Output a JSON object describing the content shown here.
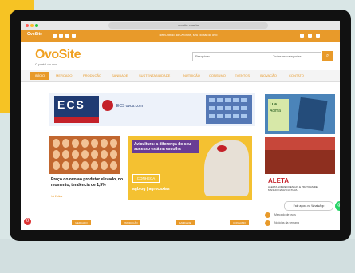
{
  "browser": {
    "url": "ovosite.com.br"
  },
  "header": {
    "small_logo": "OvoSite",
    "ticker": "Bem-vindo ao OvoSite, seu portal do ovo"
  },
  "logo": {
    "name": "OvoSite",
    "tagline": "O portal do ovo"
  },
  "search": {
    "placeholder": "Pesquisar",
    "category": "Todas as categorias",
    "button_icon": "search-icon"
  },
  "nav": {
    "active": "INÍCIO",
    "items": [
      "MERCADO",
      "PRODUÇÃO",
      "SANIDADE",
      "SUSTENTABILIDADE",
      "NUTRIÇÃO",
      "CONSUMO",
      "EVENTOS",
      "INOVAÇÃO",
      "CONTATO"
    ]
  },
  "banner": {
    "brand": "ECS",
    "text": "ECS ovos.com"
  },
  "side_ad1": {
    "line1": "Lua",
    "line2": "Acima"
  },
  "news": {
    "title": "Preço do ovo ao produtor elevado, no momento, tendência de 1,5%",
    "meta": "há 2 dias"
  },
  "promo": {
    "title": "Avicultura: a diferença do seu sucesso está na escolha",
    "button": "CONHEÇA",
    "logos": "agblog | agrocaxias"
  },
  "side_ad2": {
    "title": "ALETA",
    "subtitle": "ALERTA SOBRE DOENÇAS E PRÁTICAS DE MANEJO NA AVICULTURA"
  },
  "whatsapp": {
    "bubble": "Fale agora no WhatsApp",
    "icon": "whatsapp-icon"
  },
  "side_links": [
    "Mercado de ovos",
    "Notícias da semana",
    "Artigos técnicos"
  ],
  "bottom_tags": [
    "MERCADO",
    "PRODUÇÃO",
    "SANIDADE",
    "CONSUMO"
  ],
  "badge": "0",
  "colors": {
    "accent": "#e89a2a",
    "brand_yellow": "#f6c324"
  }
}
